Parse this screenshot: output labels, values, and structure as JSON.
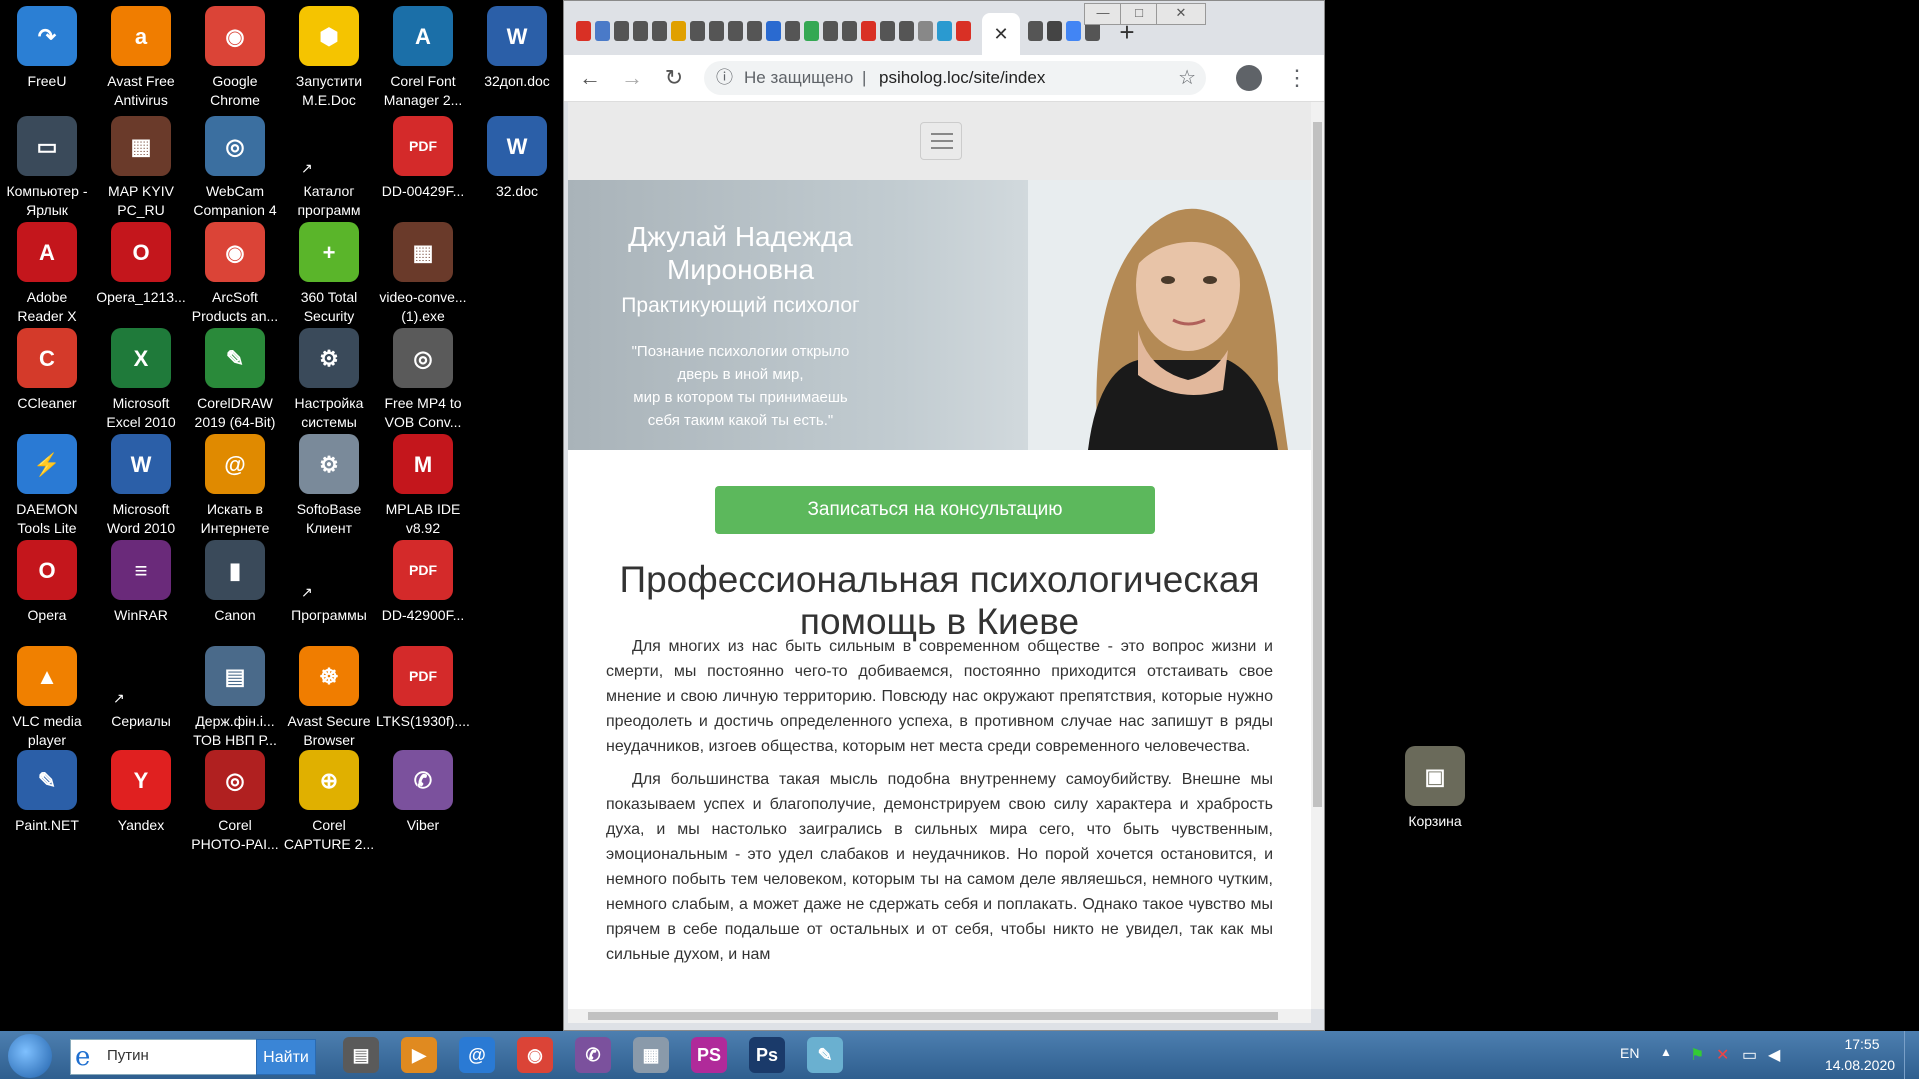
{
  "desktop": {
    "icons": [
      {
        "label": "FreeU",
        "color": "#2b7fd4",
        "glyph": "↷",
        "col": 0,
        "row": 0
      },
      {
        "label": "Avast Free\nAntivirus",
        "color": "#f07d00",
        "glyph": "a",
        "col": 1,
        "row": 0
      },
      {
        "label": "Google\nChrome",
        "color": "#db4437",
        "glyph": "◉",
        "col": 2,
        "row": 0
      },
      {
        "label": "Запустити\nM.E.Doc",
        "color": "#f5c400",
        "glyph": "⬢",
        "col": 3,
        "row": 0
      },
      {
        "label": "Corel Font\nManager 2...",
        "color": "#1b6fa8",
        "glyph": "A",
        "col": 4,
        "row": 0
      },
      {
        "label": "32доп.doc",
        "color": "#2b5fa8",
        "glyph": "W",
        "col": 5,
        "row": 0
      },
      {
        "label": "Компьютер -\nЯрлык",
        "color": "#3a4a5a",
        "glyph": "▭",
        "col": 0,
        "row": 1
      },
      {
        "label": "MAP KYIV\nPC_RU",
        "color": "#6a3a2a",
        "glyph": "▦",
        "col": 1,
        "row": 1
      },
      {
        "label": "WebCam\nCompanion 4",
        "color": "#3b6fa0",
        "glyph": "◎",
        "col": 2,
        "row": 1
      },
      {
        "label": "Каталог\nпрограмм",
        "color": "#000000",
        "glyph": "",
        "col": 3,
        "row": 1
      },
      {
        "label": "DD-00429F...",
        "color": "#d42a2a",
        "glyph": "PDF",
        "col": 4,
        "row": 1
      },
      {
        "label": "32.doc",
        "color": "#2b5fa8",
        "glyph": "W",
        "col": 5,
        "row": 1
      },
      {
        "label": "Adobe\nReader X",
        "color": "#c4161c",
        "glyph": "A",
        "col": 0,
        "row": 2
      },
      {
        "label": "Opera_1213...",
        "color": "#c4161c",
        "glyph": "O",
        "col": 1,
        "row": 2
      },
      {
        "label": "ArcSoft\nProducts an...",
        "color": "#db4437",
        "glyph": "◉",
        "col": 2,
        "row": 2
      },
      {
        "label": "360 Total\nSecurity",
        "color": "#5ab52a",
        "glyph": "+",
        "col": 3,
        "row": 2
      },
      {
        "label": "video-conve...\n(1).exe",
        "color": "#6a3a2a",
        "glyph": "▦",
        "col": 4,
        "row": 2
      },
      {
        "label": "CCleaner",
        "color": "#d43a2a",
        "glyph": "C",
        "col": 0,
        "row": 3
      },
      {
        "label": "Microsoft\nExcel 2010",
        "color": "#1f7a3a",
        "glyph": "X",
        "col": 1,
        "row": 3
      },
      {
        "label": "CorelDRAW\n2019 (64-Bit)",
        "color": "#2a8a3a",
        "glyph": "✎",
        "col": 2,
        "row": 3
      },
      {
        "label": "Настройка\nсистемы",
        "color": "#3a4a5a",
        "glyph": "⚙",
        "col": 3,
        "row": 3
      },
      {
        "label": "Free MP4 to\nVOB Conv...",
        "color": "#5a5a5a",
        "glyph": "◎",
        "col": 4,
        "row": 3
      },
      {
        "label": "DAEMON\nTools Lite",
        "color": "#2a7ad4",
        "glyph": "⚡",
        "col": 0,
        "row": 4
      },
      {
        "label": "Microsoft\nWord 2010",
        "color": "#2b5fa8",
        "glyph": "W",
        "col": 1,
        "row": 4
      },
      {
        "label": "Искать в\nИнтернете",
        "color": "#e08a00",
        "glyph": "@",
        "col": 2,
        "row": 4
      },
      {
        "label": "SoftoBase\nКлиент",
        "color": "#7a8a9a",
        "glyph": "⚙",
        "col": 3,
        "row": 4
      },
      {
        "label": "MPLAB IDE\nv8.92",
        "color": "#c4161c",
        "glyph": "M",
        "col": 4,
        "row": 4
      },
      {
        "label": "Opera",
        "color": "#c4161c",
        "glyph": "O",
        "col": 0,
        "row": 5
      },
      {
        "label": "WinRAR",
        "color": "#6a2a7a",
        "glyph": "≡",
        "col": 1,
        "row": 5
      },
      {
        "label": "Canon",
        "color": "#3a4a5a",
        "glyph": "▮",
        "col": 2,
        "row": 5
      },
      {
        "label": "Программы",
        "color": "#000000",
        "glyph": "",
        "col": 3,
        "row": 5
      },
      {
        "label": "DD-42900F...",
        "color": "#d42a2a",
        "glyph": "PDF",
        "col": 4,
        "row": 5
      },
      {
        "label": "VLC media\nplayer",
        "color": "#f08000",
        "glyph": "▲",
        "col": 0,
        "row": 6
      },
      {
        "label": "Сериалы",
        "color": "#000000",
        "glyph": "",
        "col": 1,
        "row": 6
      },
      {
        "label": "Держ.фін.і...\nТОВ НВП Р...",
        "color": "#4a6a8a",
        "glyph": "▤",
        "col": 2,
        "row": 6
      },
      {
        "label": "Avast Secure\nBrowser",
        "color": "#f07d00",
        "glyph": "☸",
        "col": 3,
        "row": 6
      },
      {
        "label": "LTKS(1930f)....",
        "color": "#d42a2a",
        "glyph": "PDF",
        "col": 4,
        "row": 6
      },
      {
        "label": "Paint.NET",
        "color": "#2b5fa8",
        "glyph": "✎",
        "col": 0,
        "row": 7
      },
      {
        "label": "Yandex",
        "color": "#e02020",
        "glyph": "Y",
        "col": 1,
        "row": 7
      },
      {
        "label": "Corel\nPHOTO-PAI...",
        "color": "#b02020",
        "glyph": "◎",
        "col": 2,
        "row": 7
      },
      {
        "label": "Corel\nCAPTURE 2...",
        "color": "#e0b000",
        "glyph": "⊕",
        "col": 3,
        "row": 7
      },
      {
        "label": "Viber",
        "color": "#7b519d",
        "glyph": "✆",
        "col": 4,
        "row": 7
      }
    ],
    "recycle": {
      "label": "Корзина"
    }
  },
  "browser": {
    "window_buttons": [
      "—",
      "□",
      "✕"
    ],
    "active_tab_close": "✕",
    "new_tab": "+",
    "toolbar": {
      "back": "←",
      "forward": "→",
      "reload": "↻",
      "security_label": "Не защищено",
      "separator": "|",
      "url": "psiholog.loc/site/index",
      "star": "☆",
      "menu": "⋮"
    },
    "tab_favicon_colors": [
      "#d93025",
      "#4a7ac8",
      "#555",
      "#555",
      "#555",
      "#e0a000",
      "#555",
      "#555",
      "#555",
      "#555",
      "#2a6ad0",
      "#555",
      "#34a853",
      "#555",
      "#555",
      "#d93025",
      "#555",
      "#555",
      "#888",
      "#2a9ad0",
      "#d93025"
    ],
    "tab_favicon_colors_after": [
      "#555",
      "#444",
      "#4285f4",
      "#555"
    ]
  },
  "page": {
    "hero": {
      "name": "Джулай Надежда Мироновна",
      "role": "Практикующий психолог",
      "quote": "\"Познание психологии открыло\nдверь в иной мир,\nмир в котором ты принимаешь\nсебя таким какой ты есть.\""
    },
    "cta_label": "Записаться на консультацию",
    "title": "Профессиональная психологическая помощь в Киеве",
    "paragraphs": [
      "Для многих из нас быть сильным в современном обществе - это вопрос жизни и смерти, мы постоянно чего-то добиваемся, постоянно приходится отстаивать свое мнение и свою личную территорию. Повсюду нас окружают препятствия, которые нужно преодолеть и достичь определенного успеха, в противном случае нас запишут в ряды неудачников, изгоев общества, которым нет места среди современного человечества.",
      "Для большинства такая мысль подобна внутреннему самоубийству. Внешне мы показываем успех и благополучие, демонстрируем свою силу характера и храбрость духа, и мы настолько заигрались в сильных мира сего, что быть чувственным, эмоциональным - это удел слабаков и неудачников. Но порой хочется остановится, и немного побыть тем человеком, которым ты на самом деле являешься, немного чутким, немного слабым, а может даже не сдержать себя и поплакать. Однако такое чувство мы прячем в себе подальше от остальных и от себя, чтобы никто не увидел, так как мы сильные духом, и нам"
    ]
  },
  "taskbar": {
    "search_value": "Путин",
    "search_button": "Найти",
    "apps": [
      {
        "name": "printer",
        "color": "#5a5a5a",
        "glyph": "▤"
      },
      {
        "name": "media-player",
        "color": "#e08a20",
        "glyph": "▶"
      },
      {
        "name": "mail",
        "color": "#2a7ad4",
        "glyph": "@"
      },
      {
        "name": "chrome",
        "color": "#db4437",
        "glyph": "◉"
      },
      {
        "name": "viber",
        "color": "#7b519d",
        "glyph": "✆"
      },
      {
        "name": "calculator",
        "color": "#8a9aaa",
        "glyph": "▦"
      },
      {
        "name": "phpstorm",
        "color": "#b02a9a",
        "glyph": "PS"
      },
      {
        "name": "photoshop",
        "color": "#1a3a6a",
        "glyph": "Ps"
      },
      {
        "name": "notepad",
        "color": "#6ab0d0",
        "glyph": "✎"
      }
    ],
    "lang": "EN",
    "time": "17:55",
    "date": "14.08.2020"
  }
}
